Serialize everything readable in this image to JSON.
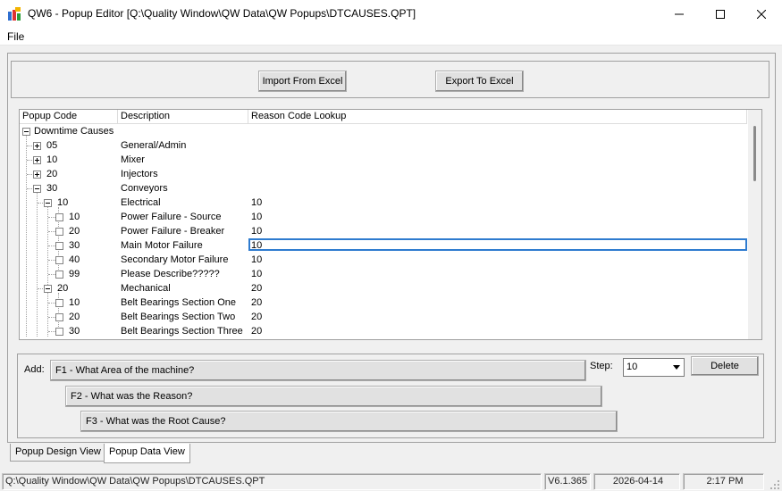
{
  "window": {
    "title": "QW6 - Popup Editor  [Q:\\Quality Window\\QW Data\\QW Popups\\DTCAUSES.QPT]"
  },
  "menu": {
    "file": "File"
  },
  "toolbar": {
    "import_label": "Import From Excel",
    "export_label": "Export To Excel"
  },
  "tree": {
    "columns": [
      "Popup Code",
      "Description",
      "Reason Code Lookup"
    ],
    "rows": [
      {
        "code": "Downtime Causes",
        "desc": "",
        "lookup": ""
      },
      {
        "code": "05",
        "desc": "General/Admin",
        "lookup": ""
      },
      {
        "code": "10",
        "desc": "Mixer",
        "lookup": ""
      },
      {
        "code": "20",
        "desc": "Injectors",
        "lookup": ""
      },
      {
        "code": "30",
        "desc": "Conveyors",
        "lookup": ""
      },
      {
        "code": "10",
        "desc": "Electrical",
        "lookup": "10"
      },
      {
        "code": "10",
        "desc": "Power Failure - Source",
        "lookup": "10"
      },
      {
        "code": "20",
        "desc": "Power Failure - Breaker",
        "lookup": "10"
      },
      {
        "code": "30",
        "desc": "Main Motor Failure",
        "lookup": "10"
      },
      {
        "code": "40",
        "desc": "Secondary Motor Failure",
        "lookup": "10"
      },
      {
        "code": "99",
        "desc": "Please Describe?????",
        "lookup": "10"
      },
      {
        "code": "20",
        "desc": "Mechanical",
        "lookup": "20"
      },
      {
        "code": "10",
        "desc": "Belt Bearings Section One",
        "lookup": "20"
      },
      {
        "code": "20",
        "desc": "Belt Bearings Section Two",
        "lookup": "20"
      },
      {
        "code": "30",
        "desc": "Belt Bearings Section Three",
        "lookup": "20"
      }
    ]
  },
  "add_panel": {
    "add_label": "Add:",
    "f1": "F1 - What Area of the machine?",
    "f2": "F2 - What was the Reason?",
    "f3": "F3 - What was the Root Cause?",
    "step_label": "Step:",
    "step_value": "10",
    "delete_label": "Delete"
  },
  "tabs": [
    "Popup Design View",
    "Popup Data View"
  ],
  "status": {
    "path": "Q:\\Quality Window\\QW Data\\QW Popups\\DTCAUSES.QPT",
    "version": "V6.1.365",
    "date": "2026-04-14",
    "time": "2:17 PM"
  }
}
